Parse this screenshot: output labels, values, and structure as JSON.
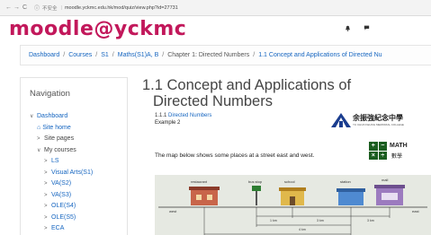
{
  "browser": {
    "not_secure": "不安全",
    "url": "moodle.yckmc.edu.hk/mod/quiz/view.php?id=27731"
  },
  "brand": "moodle@yckmc",
  "breadcrumb": [
    "Dashboard",
    "Courses",
    "S1",
    "Maths(S1)A, B",
    "Chapter 1: Directed Numbers",
    "1.1 Concept and Applications of Directed Nu"
  ],
  "navigation": {
    "title": "Navigation",
    "items": [
      "Dashboard",
      "Site home",
      "Site pages",
      "My courses",
      "LS",
      "Visual Arts(S1)",
      "VA(S2)",
      "VA(S3)",
      "OLE(S4)",
      "OLE(S5)",
      "ECA"
    ]
  },
  "main": {
    "title_line1": "1.1 Concept and Applications of",
    "title_line2": "Directed Numbers",
    "section_prefix": "1.1.1 ",
    "section_link": "Directed Numbers",
    "example": "Example 2",
    "text": "The map below shows some places at a street east and west.",
    "school_cn": "余振強紀念中學",
    "school_en": "YU CHUN KEUNG MEMORIAL COLLEGE",
    "math_en": "MATH",
    "math_cn": "數學",
    "math_symbols": [
      "+",
      "−",
      "×",
      "÷"
    ]
  },
  "map": {
    "labels": [
      "restaurant",
      "bus stop",
      "school",
      "station",
      "mall"
    ],
    "direction_west": "west",
    "direction_east": "east",
    "distances": [
      "1 km",
      "3 km",
      "4 km",
      "3 km"
    ]
  },
  "colors": {
    "brand": "#c2185b",
    "link": "#1565c0",
    "math_green": "#1b5e20"
  }
}
